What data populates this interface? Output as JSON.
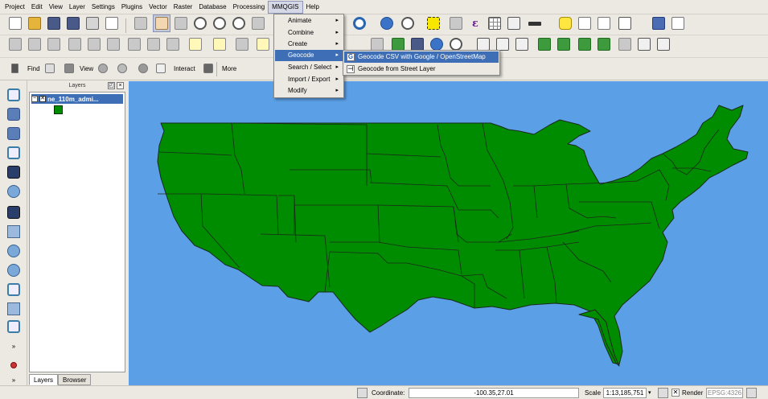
{
  "menubar": {
    "items": [
      "Project",
      "Edit",
      "View",
      "Layer",
      "Settings",
      "Plugins",
      "Vector",
      "Raster",
      "Database",
      "Processing",
      "MMQGIS",
      "Help"
    ],
    "active_index": 10
  },
  "toolbar3": {
    "find_label": "Find",
    "view_label": "View",
    "interact_label": "Interact",
    "more_label": "More"
  },
  "mmqgis_menu": {
    "items": [
      {
        "label": "Animate",
        "has_submenu": true
      },
      {
        "label": "Combine",
        "has_submenu": true
      },
      {
        "label": "Create",
        "has_submenu": true
      },
      {
        "label": "Geocode",
        "has_submenu": true
      },
      {
        "label": "Search / Select",
        "has_submenu": true
      },
      {
        "label": "Import / Export",
        "has_submenu": true
      },
      {
        "label": "Modify",
        "has_submenu": true
      }
    ],
    "highlighted": "Geocode"
  },
  "geocode_submenu": {
    "items": [
      {
        "label": "Geocode CSV with Google / OpenStreetMap",
        "icon": "google-g-icon"
      },
      {
        "label": "Geocode from Street Layer",
        "icon": "street-layer-icon"
      }
    ],
    "highlighted": "Geocode CSV with Google / OpenStreetMap"
  },
  "layers_panel": {
    "title": "Layers",
    "layer_name": "ne_110m_admi...",
    "layer_checked": true,
    "legend_color": "#008c00",
    "tabs": [
      "Layers",
      "Browser"
    ],
    "active_tab": "Layers"
  },
  "map": {
    "background_color": "#5ba0e6",
    "feature_color": "#008c00",
    "stroke_color": "#1a2a1a",
    "subject": "United States states polygons"
  },
  "statusbar": {
    "coordinate_label": "Coordinate:",
    "coordinate_value": "-100.35,27.01",
    "scale_label": "Scale",
    "scale_value": "1:13,185,751",
    "render_label": "Render",
    "render_checked": true,
    "crs_label": "EPSG:4326"
  }
}
